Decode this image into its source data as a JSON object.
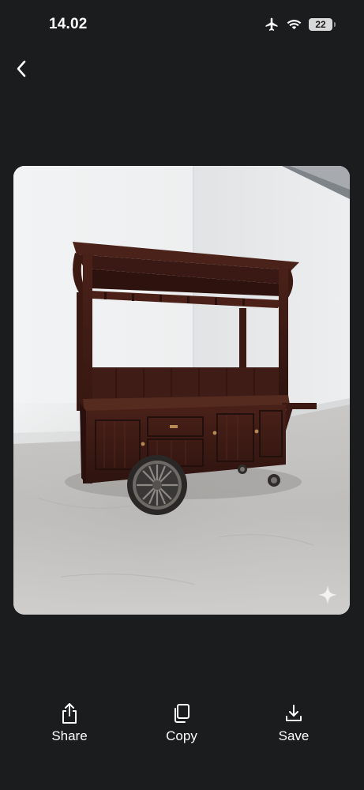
{
  "status_bar": {
    "time": "14.02",
    "battery_level": "22",
    "icons": [
      "airplane-icon",
      "wifi-icon",
      "battery-icon"
    ]
  },
  "navigation": {
    "back_icon": "chevron-left-icon"
  },
  "photo": {
    "subject": "dark wooden vendor cart with canopy and wheels",
    "watermark_icon": "sparkle-icon"
  },
  "actions": {
    "share_label": "Share",
    "copy_label": "Copy",
    "save_label": "Save",
    "share_icon": "share-icon",
    "copy_icon": "copy-icon",
    "save_icon": "download-icon"
  },
  "colors": {
    "background": "#1b1c1e",
    "text": "#ffffff",
    "wood": "#3b1a14"
  }
}
